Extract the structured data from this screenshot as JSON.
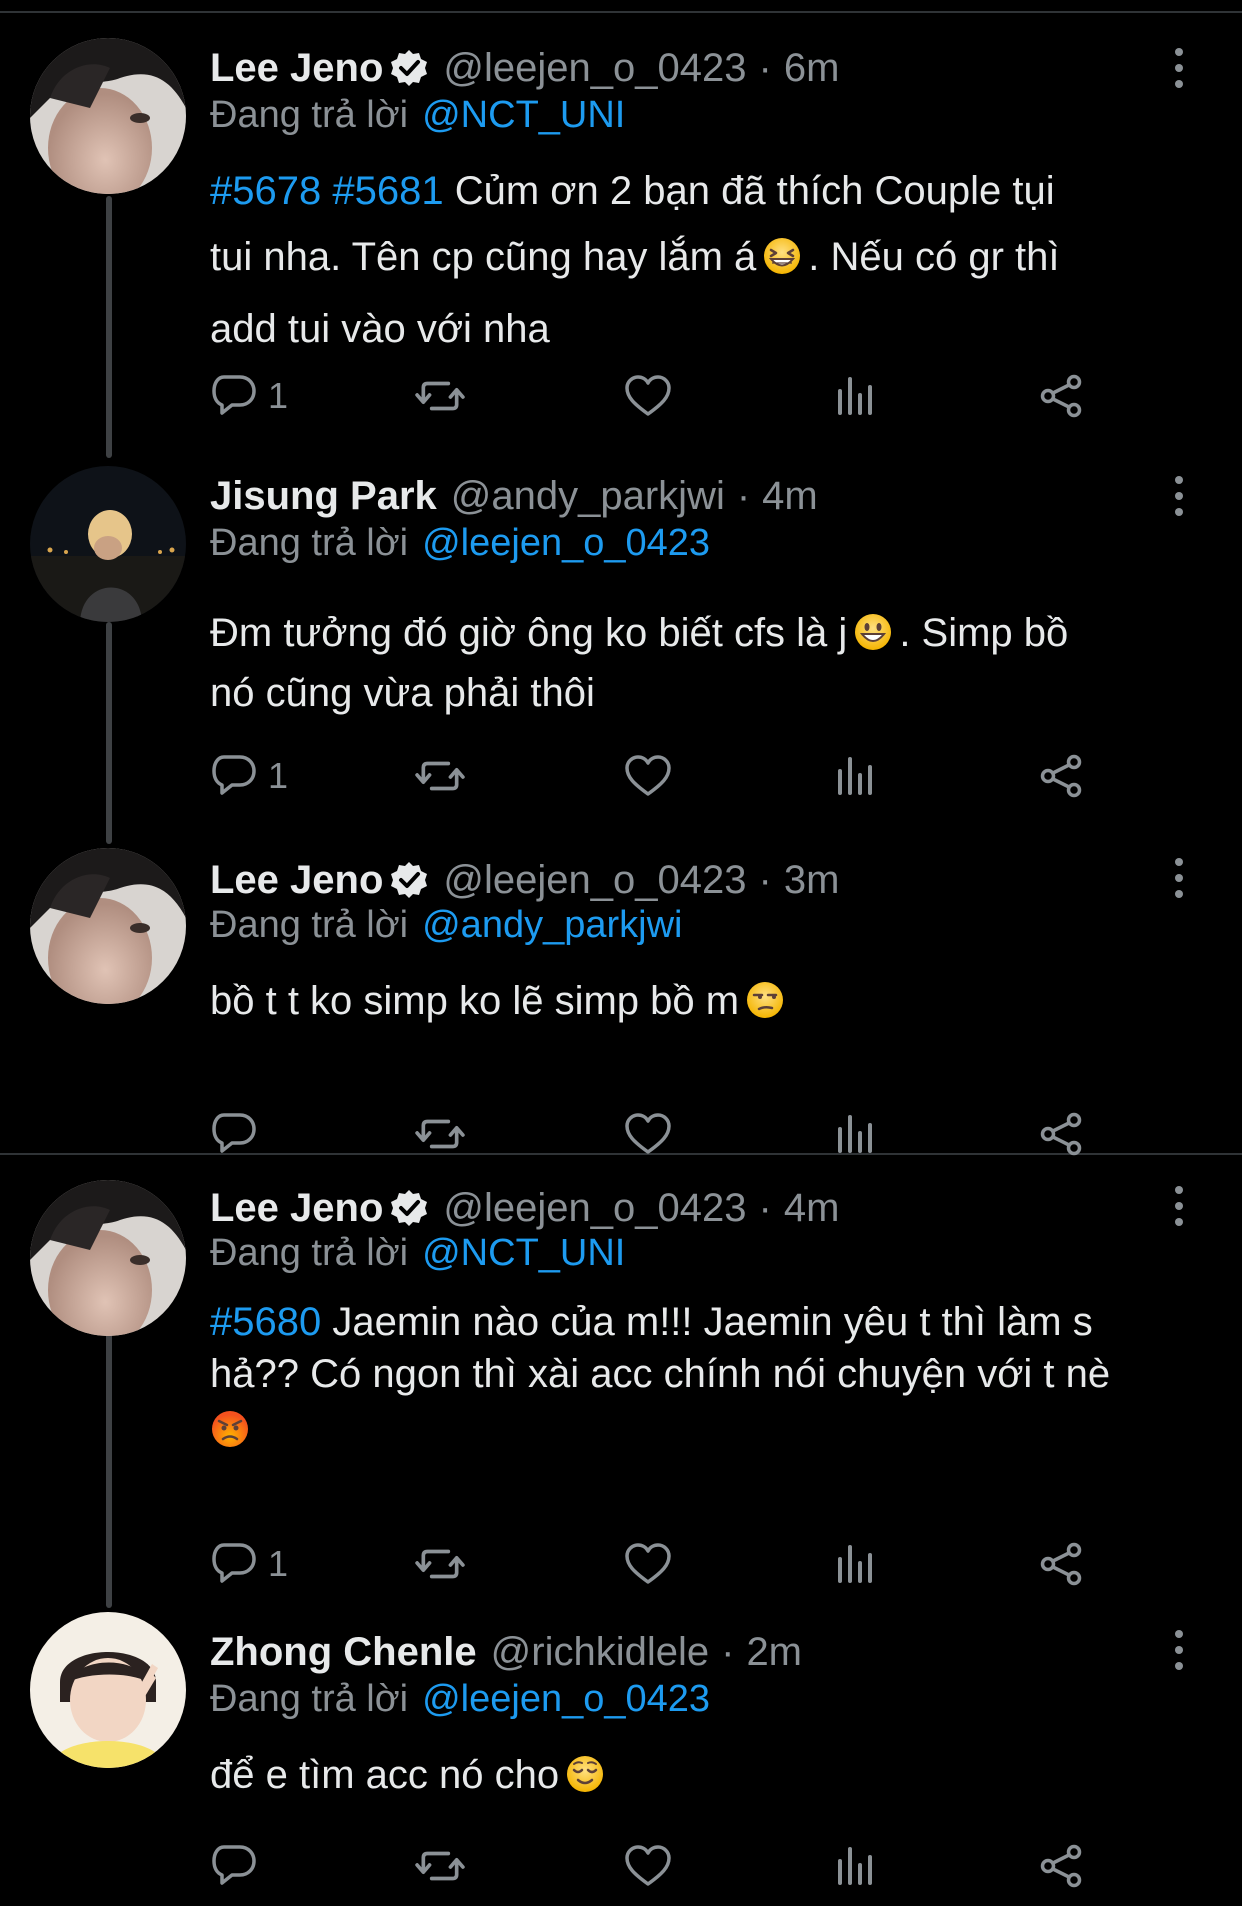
{
  "tweets": [
    {
      "name": "Lee Jeno",
      "verified": true,
      "handle": "@leejen_o_0423",
      "time": "6m",
      "reply_prefix": "Đang trả lời",
      "reply_to": "@NCT_UNI",
      "hashtags": "#5678 #5681",
      "text_line1": "Củm ơn 2 bạn đã thích Couple tụi",
      "text_line2a": "tui nha. Tên cp cũng hay lắm á",
      "text_line2b": ". Nếu có gr thì",
      "text_line3": "add tui vào với nha",
      "reply_count": "1",
      "emoji": "grinning-squinting-face"
    },
    {
      "name": "Jisung Park",
      "verified": false,
      "handle": "@andy_parkjwi",
      "time": "4m",
      "reply_prefix": "Đang trả lời",
      "reply_to": "@leejen_o_0423",
      "text_line1a": "Đm tưởng đó giờ ông ko biết cfs là j",
      "text_line1b": ". Simp bồ",
      "text_line2": "nó cũng vừa phải thôi",
      "reply_count": "1",
      "emoji": "grinning-face"
    },
    {
      "name": "Lee Jeno",
      "verified": true,
      "handle": "@leejen_o_0423",
      "time": "3m",
      "reply_prefix": "Đang trả lời",
      "reply_to": "@andy_parkjwi",
      "text_line1": "bồ t t ko simp ko lẽ simp bồ m",
      "reply_count": "",
      "emoji": "unamused-face"
    },
    {
      "name": "Lee Jeno",
      "verified": true,
      "handle": "@leejen_o_0423",
      "time": "4m",
      "reply_prefix": "Đang trả lời",
      "reply_to": "@NCT_UNI",
      "hashtag": "#5680",
      "text_line1": "Jaemin nào của m!!! Jaemin yêu t thì làm s",
      "text_line2": "hả?? Có ngon thì xài acc chính nói chuyện với t nè",
      "reply_count": "1",
      "emoji": "angry-face"
    },
    {
      "name": "Zhong Chenle",
      "verified": false,
      "handle": "@richkidlele",
      "time": "2m",
      "reply_prefix": "Đang trả lời",
      "reply_to": "@leejen_o_0423",
      "text_line1": "để e tìm acc nó cho",
      "reply_count": "",
      "emoji": "relieved-face"
    }
  ],
  "separator": "·",
  "colors": {
    "background": "#000000",
    "text": "#e7e9ea",
    "muted": "#8b9196",
    "accent": "#1d9bf0",
    "divider": "#2f3336"
  }
}
